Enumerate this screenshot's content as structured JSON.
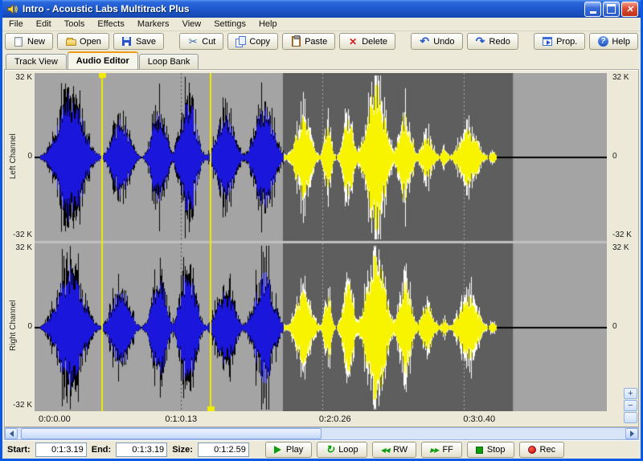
{
  "window": {
    "title": "Intro - Acoustic Labs Multitrack Plus"
  },
  "menu_bar": {
    "items": [
      "File",
      "Edit",
      "Tools",
      "Effects",
      "Markers",
      "View",
      "Settings",
      "Help"
    ]
  },
  "toolbar": {
    "buttons": [
      {
        "label": "New",
        "icon": "new-document-icon"
      },
      {
        "label": "Open",
        "icon": "open-folder-icon"
      },
      {
        "label": "Save",
        "icon": "save-floppy-icon"
      },
      {
        "label": "Cut",
        "icon": "cut-scissors-icon"
      },
      {
        "label": "Copy",
        "icon": "copy-pages-icon"
      },
      {
        "label": "Paste",
        "icon": "paste-clipboard-icon"
      },
      {
        "label": "Delete",
        "icon": "delete-x-icon"
      },
      {
        "label": "Undo",
        "icon": "undo-arrow-icon"
      },
      {
        "label": "Redo",
        "icon": "redo-arrow-icon"
      },
      {
        "label": "Prop.",
        "icon": "properties-icon"
      },
      {
        "label": "Help",
        "icon": "help-question-icon"
      }
    ]
  },
  "tabs": {
    "items": [
      {
        "label": "Track View",
        "active": false
      },
      {
        "label": "Audio Editor",
        "active": true
      },
      {
        "label": "Loop Bank",
        "active": false
      }
    ]
  },
  "editor": {
    "channels": [
      {
        "name": "Left Channel",
        "labels": {
          "top": "32 K",
          "zero": "0",
          "bottom": "-32 K"
        }
      },
      {
        "name": "Right Channel",
        "labels": {
          "top": "32 K",
          "zero": "0",
          "bottom": "-32 K"
        }
      }
    ],
    "time_labels": [
      {
        "text": "0:0:0.00",
        "frac": 0.007,
        "align": "left"
      },
      {
        "text": "0:1:0.13",
        "frac": 0.256,
        "align": "center"
      },
      {
        "text": "0:2:0.26",
        "frac": 0.525,
        "align": "center"
      },
      {
        "text": "0:3:0.40",
        "frac": 0.777,
        "align": "center"
      }
    ],
    "selection": {
      "start_frac": 0.434,
      "end_frac": 0.836
    },
    "markers": [
      {
        "frac": 0.118,
        "handle": "top"
      },
      {
        "frac": 0.308,
        "handle": "bottom"
      }
    ],
    "gridline_fracs": [
      0.256,
      0.503,
      0.75
    ],
    "colors": {
      "pane_bg": "#a4a4a4",
      "selection_bg": "#5e5e5e",
      "wave_fill": "#1a16dc",
      "wave_edge": "#000000",
      "wave_fill_selected": "#f8f400",
      "wave_edge_selected": "#ffffff",
      "center_line": "#000000",
      "marker": "#f0eb00",
      "grid_light": "#4f4f4f",
      "grid_dark": "#a8a8a8",
      "separator": "#c0c0c0"
    },
    "bursts": {
      "left": [
        [
          0.0625,
          0.028,
          0.82
        ],
        [
          0.15,
          0.019,
          0.52
        ],
        [
          0.217,
          0.0155,
          0.62
        ],
        [
          0.2676,
          0.017,
          0.8
        ],
        [
          0.333,
          0.0197,
          0.55
        ],
        [
          0.401,
          0.021,
          0.68
        ],
        [
          0.469,
          0.017,
          0.52
        ],
        [
          0.512,
          0.0077,
          0.45
        ],
        [
          0.548,
          0.011,
          0.6
        ],
        [
          0.596,
          0.0197,
          0.97
        ],
        [
          0.647,
          0.014,
          0.55
        ],
        [
          0.686,
          0.0126,
          0.28
        ],
        [
          0.7156,
          0.007,
          0.12
        ],
        [
          0.7577,
          0.0197,
          0.38
        ],
        [
          0.8,
          0.006,
          0.08
        ]
      ],
      "right": [
        [
          0.0625,
          0.028,
          0.78
        ],
        [
          0.15,
          0.019,
          0.55
        ],
        [
          0.217,
          0.0155,
          0.65
        ],
        [
          0.2676,
          0.017,
          0.82
        ],
        [
          0.333,
          0.0197,
          0.5
        ],
        [
          0.401,
          0.021,
          0.72
        ],
        [
          0.469,
          0.017,
          0.48
        ],
        [
          0.512,
          0.0077,
          0.42
        ],
        [
          0.548,
          0.011,
          0.62
        ],
        [
          0.596,
          0.0197,
          1.0
        ],
        [
          0.647,
          0.014,
          0.6
        ],
        [
          0.686,
          0.0126,
          0.3
        ],
        [
          0.7156,
          0.007,
          0.1
        ],
        [
          0.7577,
          0.0197,
          0.42
        ],
        [
          0.8,
          0.006,
          0.08
        ]
      ]
    }
  },
  "zoom_controls": {
    "zoom_in": "+",
    "zoom_out": "−"
  },
  "h_scrollbar": {
    "thumb_start_frac": 0.005,
    "thumb_end_frac": 0.5
  },
  "status_bar": {
    "fields": [
      {
        "label": "Start:",
        "value": "0:1:3.19"
      },
      {
        "label": "End:",
        "value": "0:1:3.19"
      },
      {
        "label": "Size:",
        "value": "0:1:2.59"
      }
    ],
    "transport": [
      {
        "label": "Play",
        "icon": "play-icon"
      },
      {
        "label": "Loop",
        "icon": "loop-icon"
      },
      {
        "label": "RW",
        "icon": "rewind-icon"
      },
      {
        "label": "FF",
        "icon": "fast-forward-icon"
      },
      {
        "label": "Stop",
        "icon": "stop-icon"
      },
      {
        "label": "Rec",
        "icon": "record-icon"
      }
    ]
  }
}
